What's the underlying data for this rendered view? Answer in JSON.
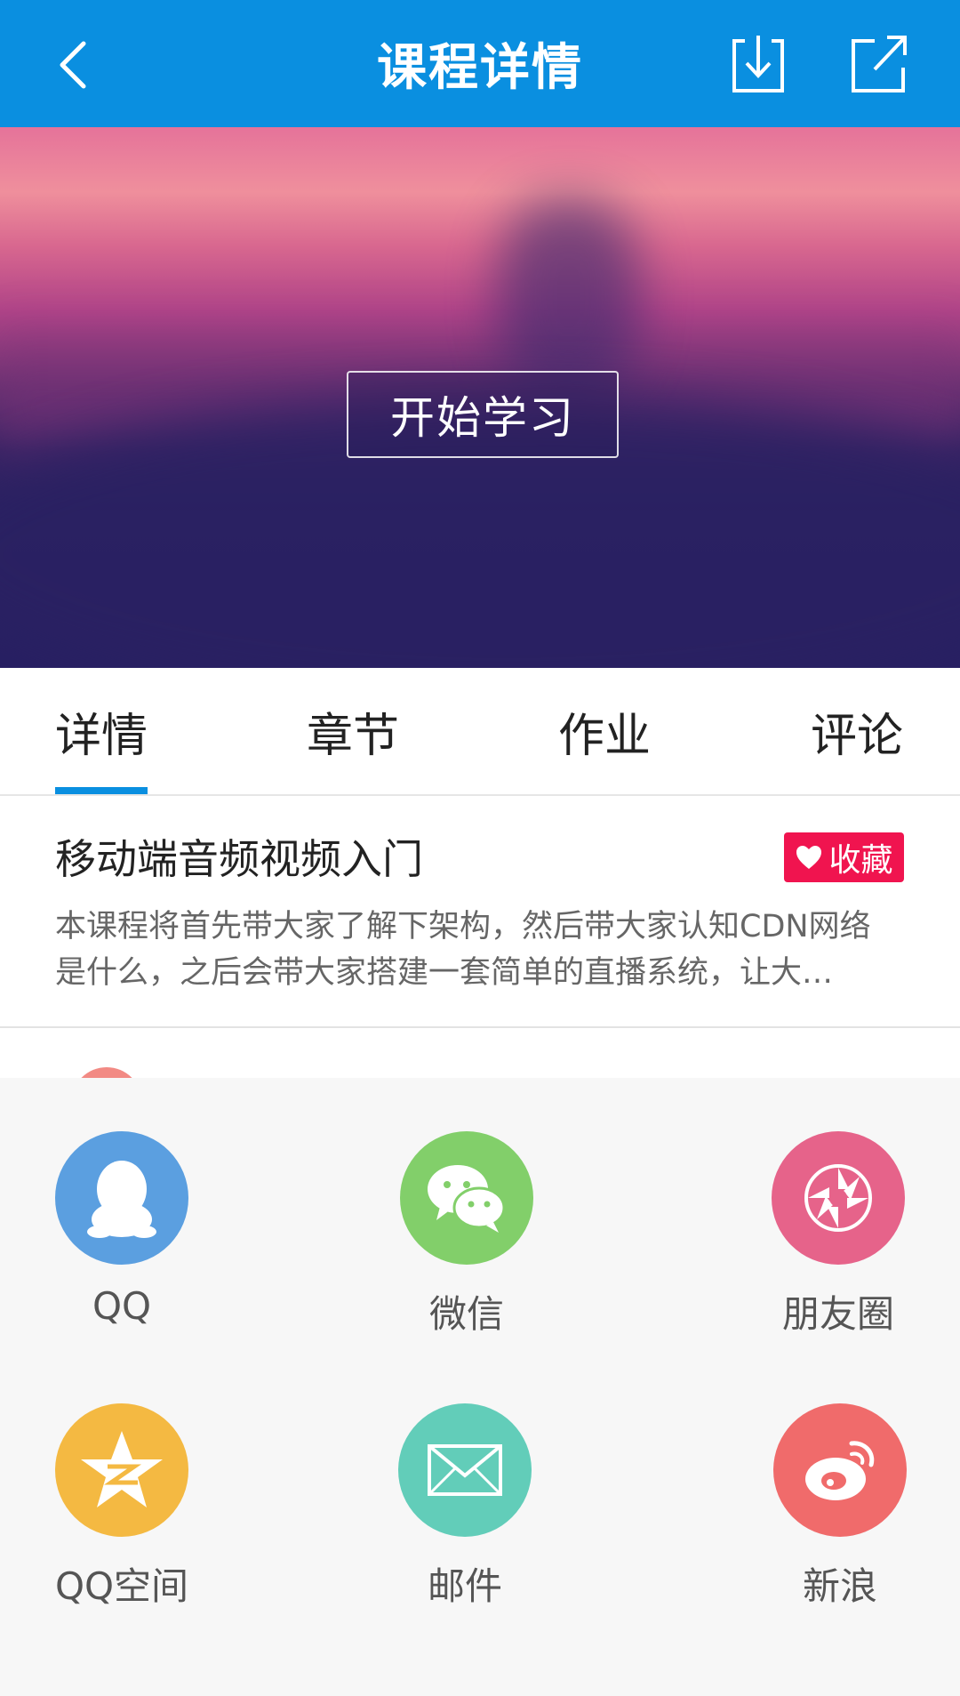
{
  "header": {
    "title": "课程详情"
  },
  "hero": {
    "start_label": "开始学习"
  },
  "tabs": [
    {
      "label": "详情",
      "active": true
    },
    {
      "label": "章节",
      "active": false
    },
    {
      "label": "作业",
      "active": false
    },
    {
      "label": "评论",
      "active": false
    }
  ],
  "course": {
    "title": "移动端音频视频入门",
    "favorite_label": "收藏",
    "description": "本课程将首先带大家了解下架构，然后带大家认知CDN网络是什么，之后会带大家搭建一套简单的直播系统，让大…"
  },
  "share": {
    "items": [
      {
        "label": "QQ",
        "icon": "qq-icon",
        "color": "#5b9fe0"
      },
      {
        "label": "微信",
        "icon": "wechat-icon",
        "color": "#82cf6a"
      },
      {
        "label": "朋友圈",
        "icon": "moments-icon",
        "color": "#e6638a"
      },
      {
        "label": "QQ空间",
        "icon": "qzone-icon",
        "color": "#f4b942"
      },
      {
        "label": "邮件",
        "icon": "mail-icon",
        "color": "#62cdb9"
      },
      {
        "label": "新浪",
        "icon": "weibo-icon",
        "color": "#f06b6b"
      }
    ]
  },
  "colors": {
    "primary": "#0a8fe0",
    "favorite": "#f0144f"
  }
}
